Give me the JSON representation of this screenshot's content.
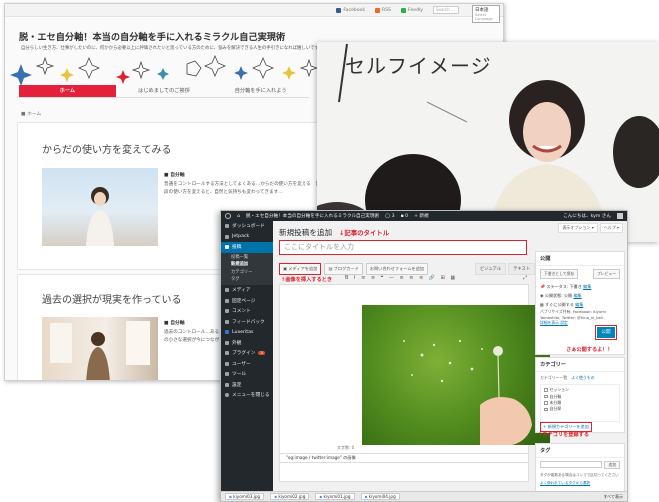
{
  "blog": {
    "topbar": {
      "facebook": "Facebook",
      "rss": "RSS",
      "feedly": "Feedly",
      "search_placeholder": "Search ...",
      "language": "日本語",
      "language_sub": "Select Language"
    },
    "title": "脱・エセ自分軸！本当の自分軸を手に入れるミラクル自己実現術",
    "tagline": "自分らしい生き方、仕事がしたいのに、何かから必要以上に評価されたいと思っている方のために、悩みを解決できる人生の手引きになれば嬉しいです",
    "nav": [
      {
        "label": "ホーム",
        "active": true
      },
      {
        "label": "はじめましてのご挨拶",
        "active": false
      },
      {
        "label": "自分軸を手に入れよう",
        "active": false
      }
    ],
    "breadcrumb": "ホーム",
    "posts": [
      {
        "title": "からだの使い方を変えてみる",
        "category": "自分軸",
        "excerpt": "普通をコントロールする方法としてよくある…からだの使い方を変える　普段の使い方を変えると、自然と気持ちも変わってきます…"
      },
      {
        "title": "過去の選択が現実を作っている",
        "category": "自分軸",
        "excerpt": "過去のコントロール…あることを意識すると…行動を変えてみる…一つ一つの小さな選択が今につながっています…"
      }
    ]
  },
  "photo": {
    "whiteboard_text": "セルフイメージ"
  },
  "wp": {
    "adminbar": {
      "site": "脱・エセ自分軸！本当の自分軸を手に入れるミラクル自己実現術",
      "comments": "3",
      "updates": "0",
      "new": "+ 新規",
      "greeting": "こんにちは、kym さん"
    },
    "screen_options": "表示オプション ▾",
    "help": "ヘルプ ▾",
    "sidebar": [
      {
        "label": "ダッシュボード"
      },
      {
        "label": "Jetpack"
      },
      {
        "label": "投稿",
        "current": true
      }
    ],
    "sidebar_sub": [
      "投稿一覧",
      "新規追加",
      "カテゴリー",
      "タグ"
    ],
    "sidebar_rest": [
      {
        "label": "メディア"
      },
      {
        "label": "固定ページ"
      },
      {
        "label": "コメント"
      },
      {
        "label": "フィードバック"
      },
      {
        "label": "Luxeritas"
      },
      {
        "label": "外観"
      },
      {
        "label": "プラグイン",
        "badge": "3"
      },
      {
        "label": "ユーザー"
      },
      {
        "label": "ツール"
      },
      {
        "label": "設定"
      },
      {
        "label": "メニューを閉じる"
      }
    ],
    "page_heading": "新規投稿を追加",
    "note_title": "↓記事のタイトル",
    "title_placeholder": "ここにタイトルを入力",
    "buttons": {
      "add_media": "メディアを追加",
      "blog_card": "ブログカード",
      "contact_form": "お問い合わせフォームを追加"
    },
    "tabs": {
      "visual": "ビジュアル",
      "text": "テキスト"
    },
    "note_media": "↑画像を挿入するとき",
    "toolbar_symbols": "B I ≡ ≡ ❝ — ≡ ≡ ≡ 🔗 ⊞ ▦",
    "word_count": "文字数: 0",
    "og_label": "\"og:image / twitter:image\" の画像",
    "files": [
      "kiyomi03.jpg",
      "kiyomi02.jpg",
      "kiyomi01.jpg",
      "kiyomi04.jpg"
    ],
    "show_all": "すべて表示",
    "publish": {
      "title": "公開",
      "save_draft": "下書きとして保存",
      "preview": "プレビュー",
      "status": "ステータス: 下書き",
      "visibility": "公開状態: 公開",
      "schedule": "すぐに公開する",
      "edit": "編集",
      "publicize": "パブリサイズ共有: Facebook: Kiyomi Yamashita, Twitter: @hina_ni_bell",
      "settings": "詳細を表示 設定",
      "publish_button": "公開"
    },
    "note_publish": "さぁ公開するよ！！",
    "categories": {
      "title": "カテゴリー",
      "tab_all": "カテゴリー一覧",
      "tab_popular": "よく使うもの",
      "items": [
        "セッション",
        "自分軸",
        "未分類",
        "自分探"
      ],
      "add_new": "+ 新規カテゴリーを追加"
    },
    "note_category": "↑カテゴリを登録する",
    "tags": {
      "title": "タグ",
      "add": "追加",
      "help": "タグが複数ある場合はコンマで区切ってください",
      "popular": "よく使われているタグから選択"
    }
  }
}
